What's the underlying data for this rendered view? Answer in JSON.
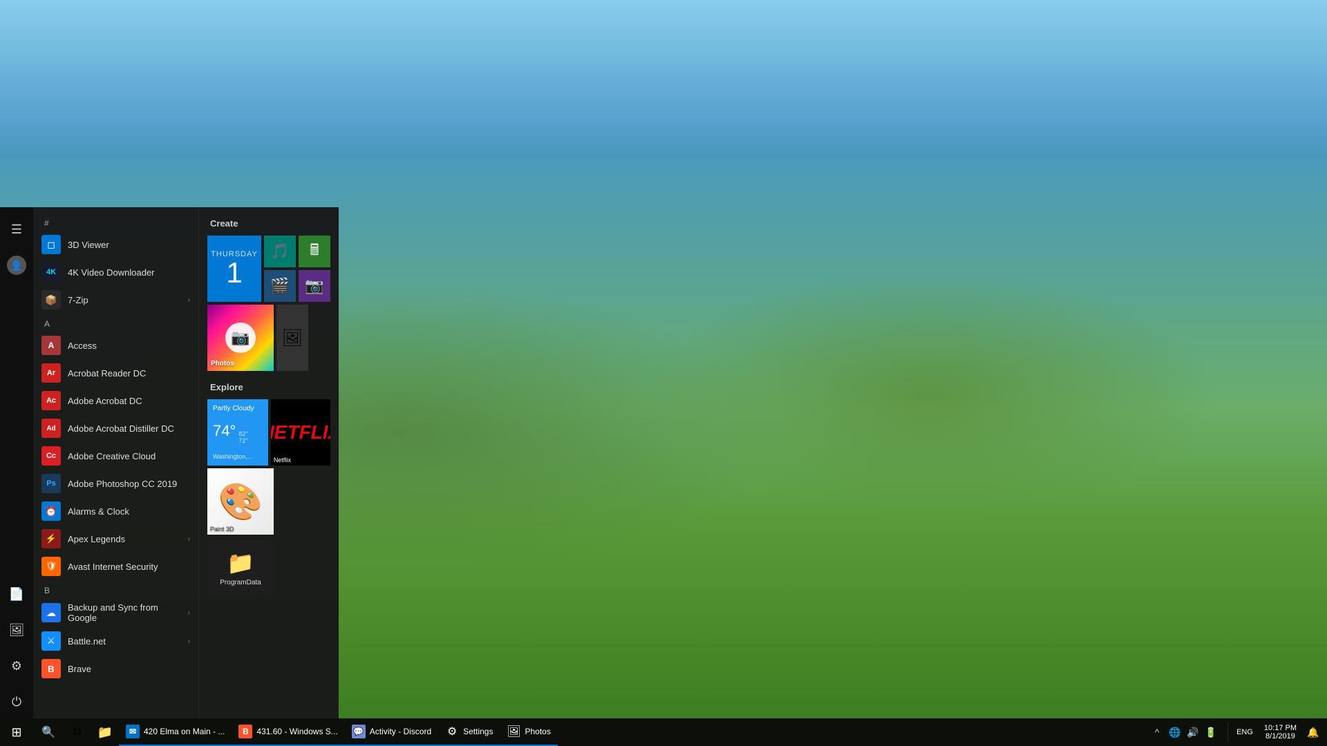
{
  "desktop": {
    "background_desc": "Mountain valley landscape with blue sky"
  },
  "start_menu": {
    "visible": true,
    "sections": {
      "hash": "#",
      "a": "A",
      "b": "B"
    },
    "app_list": [
      {
        "id": "3d-viewer",
        "label": "3D Viewer",
        "icon": "icon-3dviewer",
        "icon_char": "◻",
        "has_submenu": false
      },
      {
        "id": "4k-video",
        "label": "4K Video Downloader",
        "icon": "icon-4kvideo",
        "icon_char": "⬇",
        "has_submenu": false
      },
      {
        "id": "7zip",
        "label": "7-Zip",
        "icon": "icon-7zip",
        "icon_char": "🗜",
        "has_submenu": true
      },
      {
        "id": "access",
        "label": "Access",
        "icon": "icon-access",
        "icon_char": "A",
        "has_submenu": false
      },
      {
        "id": "acrobat-reader",
        "label": "Acrobat Reader DC",
        "icon": "icon-acrobat",
        "icon_char": "A",
        "has_submenu": false
      },
      {
        "id": "adobe-acrobat",
        "label": "Adobe Acrobat DC",
        "icon": "icon-adobeacrobat",
        "icon_char": "A",
        "has_submenu": false
      },
      {
        "id": "adobe-distiller",
        "label": "Adobe Acrobat Distiller DC",
        "icon": "icon-adobedistiller",
        "icon_char": "A",
        "has_submenu": false
      },
      {
        "id": "creative-cloud",
        "label": "Adobe Creative Cloud",
        "icon": "icon-creativecloud",
        "icon_char": "Cc",
        "has_submenu": false
      },
      {
        "id": "photoshop",
        "label": "Adobe Photoshop CC 2019",
        "icon": "icon-photoshop",
        "icon_char": "Ps",
        "has_submenu": false
      },
      {
        "id": "alarms-clock",
        "label": "Alarms & Clock",
        "icon": "icon-alarmsandclock",
        "icon_char": "⏰",
        "has_submenu": false
      },
      {
        "id": "apex-legends",
        "label": "Apex Legends",
        "icon": "icon-apex",
        "icon_char": "⚡",
        "has_submenu": true
      },
      {
        "id": "avast",
        "label": "Avast Internet Security",
        "icon": "icon-avast",
        "icon_char": "🛡",
        "has_submenu": false
      },
      {
        "id": "backup-sync",
        "label": "Backup and Sync from Google",
        "icon": "icon-backupsync",
        "icon_char": "☁",
        "has_submenu": true
      },
      {
        "id": "battle-net",
        "label": "Battle.net",
        "icon": "icon-battle",
        "icon_char": "⚔",
        "has_submenu": true
      },
      {
        "id": "brave",
        "label": "Brave",
        "icon": "icon-brave",
        "icon_char": "B",
        "has_submenu": false
      }
    ],
    "tiles": {
      "create_label": "Create",
      "explore_label": "Explore",
      "calendar": {
        "day_name": "Thursday",
        "day_num": "1"
      },
      "weather": {
        "condition": "Partly Cloudy",
        "temp": "74°",
        "high": "82°",
        "low": "72°",
        "location": "Washington,..."
      },
      "netflix_label": "Netflix",
      "photos_label": "Photos",
      "paint3d_label": "Paint 3D",
      "folder_label": "ProgramData"
    }
  },
  "taskbar": {
    "start_icon": "⊞",
    "search_icon": "🔍",
    "apps": [
      {
        "id": "file-explorer",
        "label": "File Explorer",
        "icon": "📁",
        "running": false
      },
      {
        "id": "outlook",
        "label": "420 Elma on Main - ...",
        "icon": "✉",
        "running": true
      },
      {
        "id": "brave-tb",
        "label": "431.60 - Windows S...",
        "icon": "B",
        "running": true
      },
      {
        "id": "discord",
        "label": "Activity - Discord",
        "icon": "💬",
        "running": true
      },
      {
        "id": "settings",
        "label": "Settings",
        "icon": "⚙",
        "running": true
      },
      {
        "id": "photos-tb",
        "label": "Photos",
        "icon": "🖼",
        "running": true
      }
    ],
    "systray": {
      "chevron": "^",
      "network": "🌐",
      "volume": "🔊",
      "battery": "🔋",
      "lang": "ENG"
    },
    "clock": {
      "time": "10:17 PM",
      "date": "8/1/2019"
    },
    "notification": "🔔"
  }
}
